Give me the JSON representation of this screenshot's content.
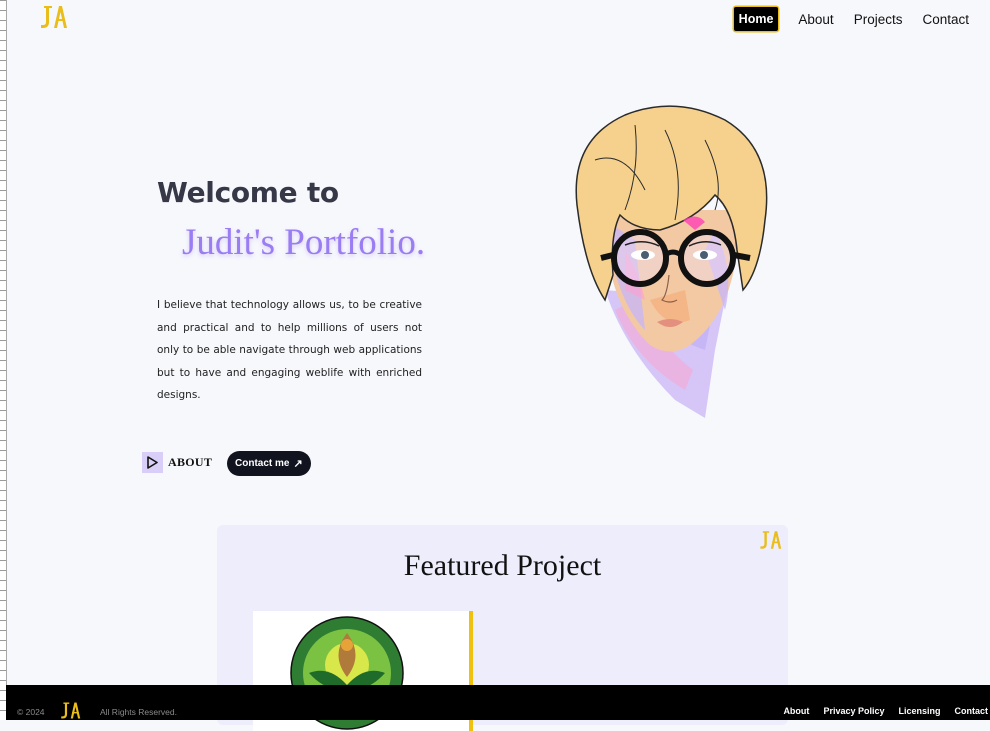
{
  "header": {
    "logo_text": "JA",
    "nav": [
      {
        "label": "Home",
        "active": true
      },
      {
        "label": "About",
        "active": false
      },
      {
        "label": "Projects",
        "active": false
      },
      {
        "label": "Contact",
        "active": false
      }
    ]
  },
  "hero": {
    "title": "Welcome to",
    "subtitle": "Judit's Portfolio.",
    "text": "I believe that technology allows us, to be creative and practical and to help millions of users not only to be able navigate through web applications but to have and engaging weblife with enriched designs.",
    "about_label": "ABOUT",
    "contact_label": "Contact me",
    "contact_icon": "arrow-up-right-icon"
  },
  "featured": {
    "title": "Featured Project",
    "logo_text": "JA"
  },
  "footer": {
    "copyright": "© 2024",
    "logo_text": "JA",
    "rights": "All Rights Reserved.",
    "links": [
      "About",
      "Privacy Policy",
      "Licensing",
      "Contact"
    ]
  },
  "colors": {
    "accent_purple": "#9a7cf3",
    "logo_gold": "#e9bd1a",
    "dark": "#11131f",
    "featured_bg": "#eeedfc"
  }
}
